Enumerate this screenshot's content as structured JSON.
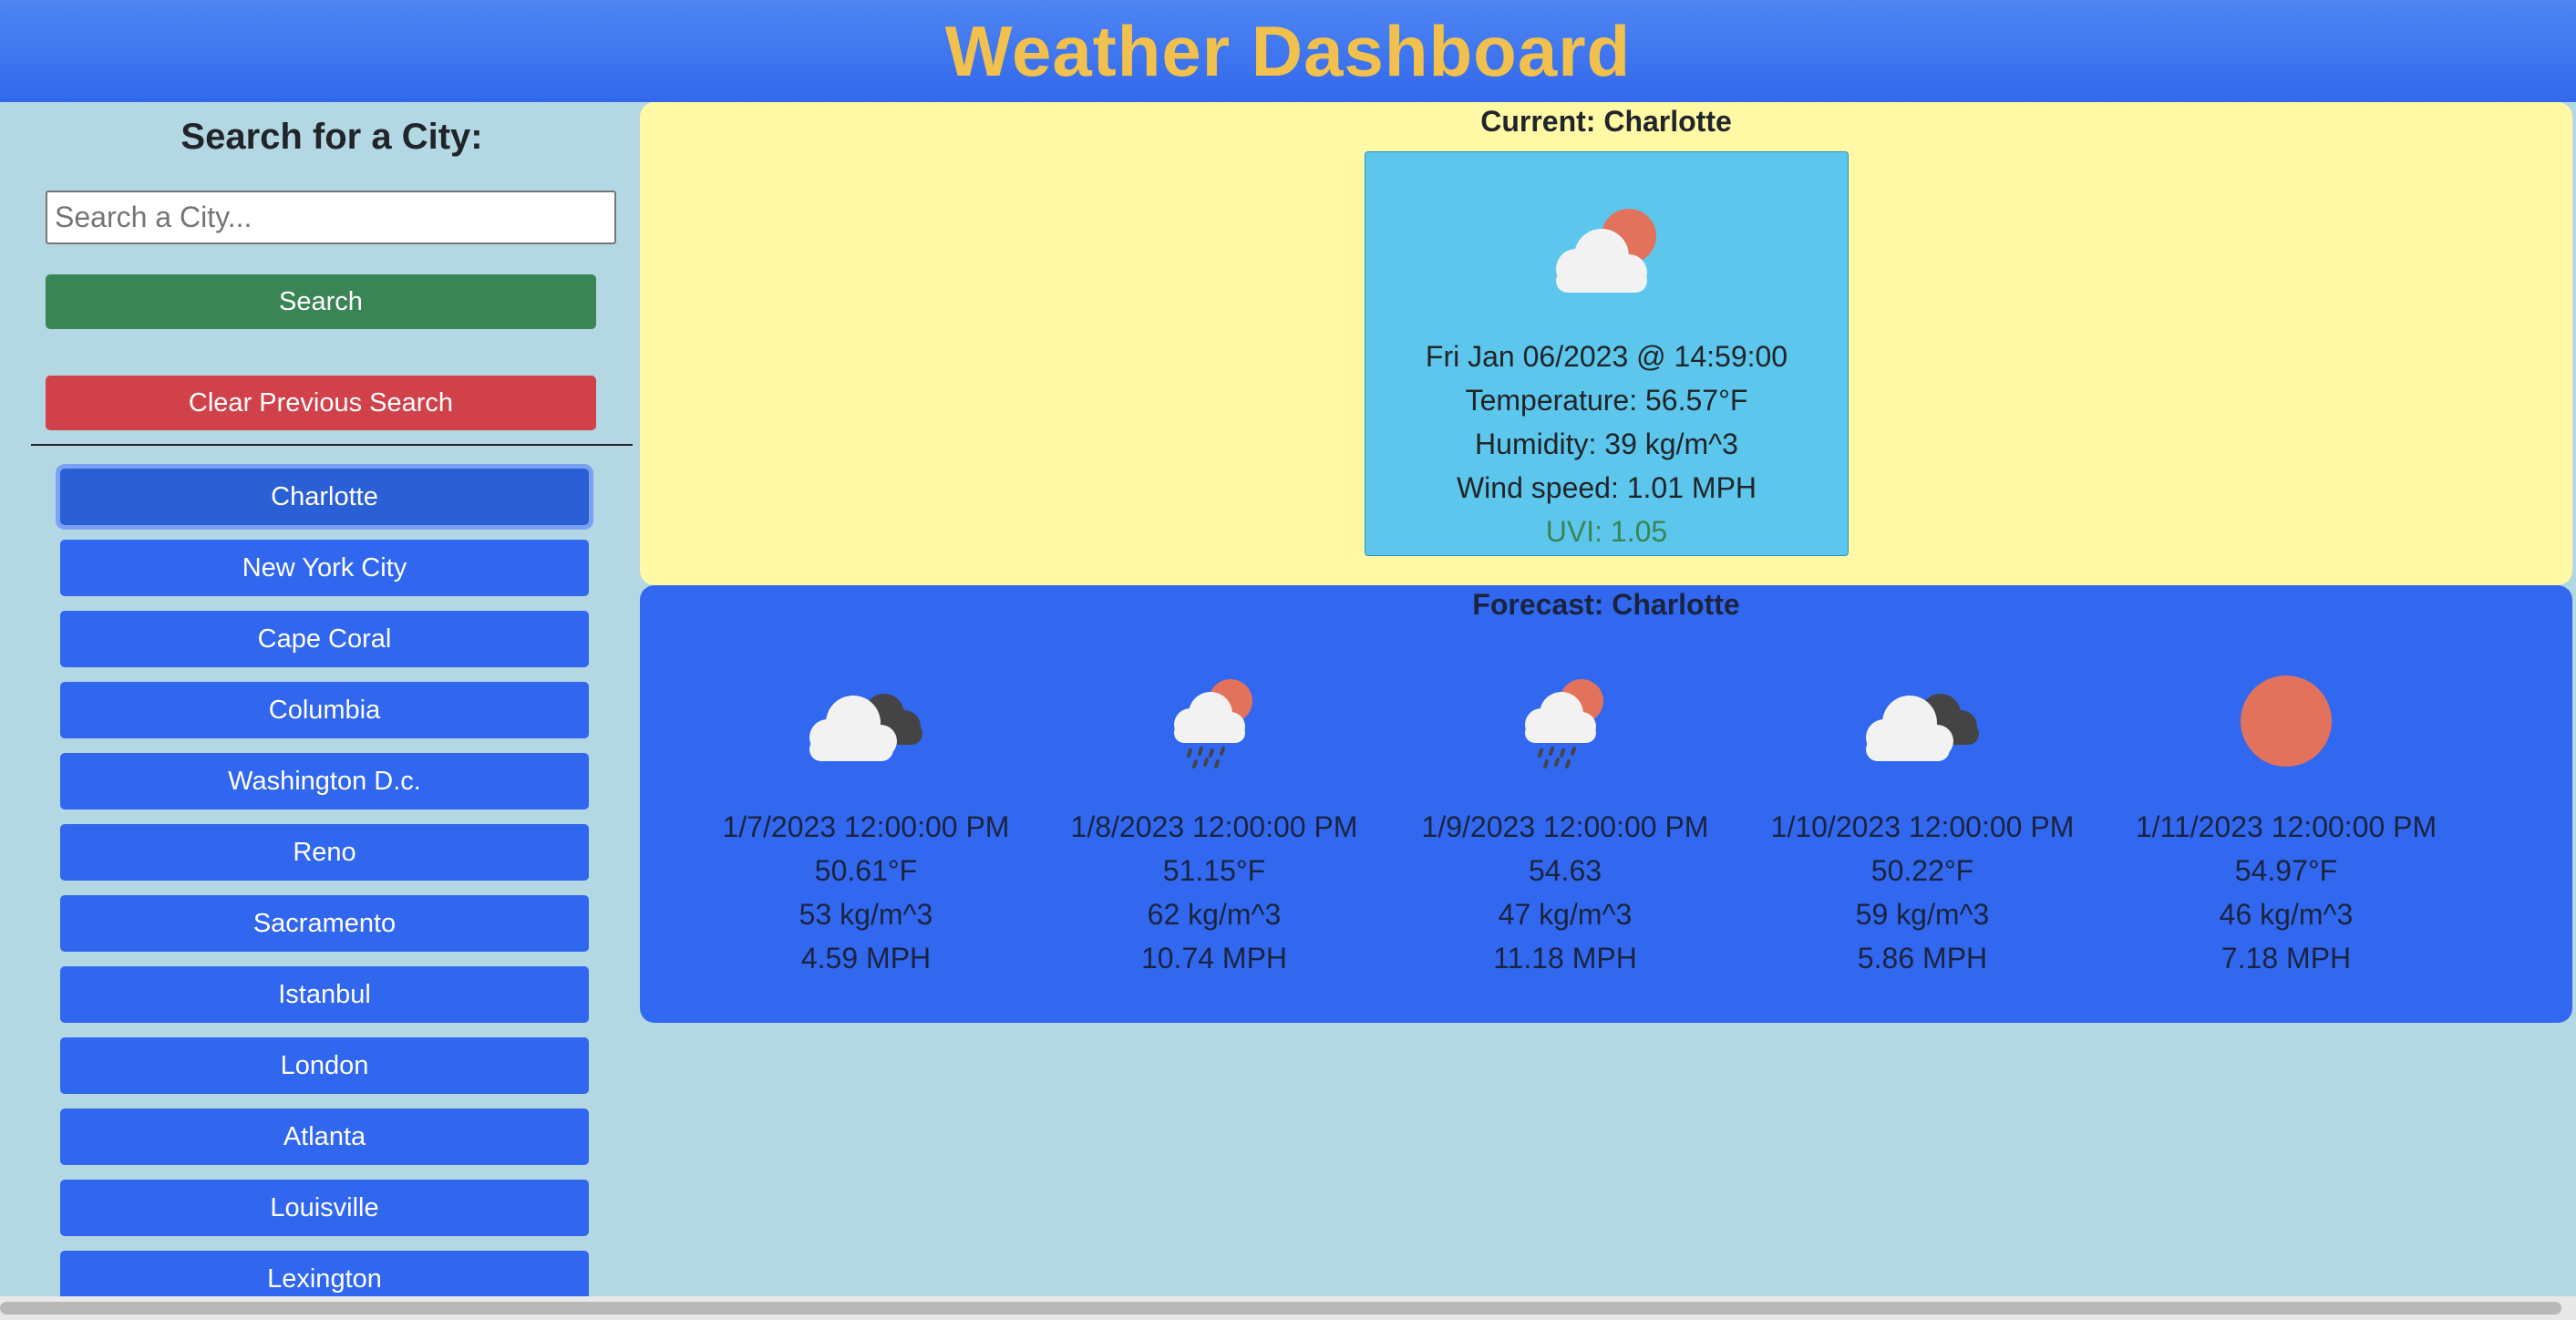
{
  "header": {
    "title": "Weather Dashboard"
  },
  "sidebar": {
    "search_title": "Search for a City:",
    "search_placeholder": "Search a City...",
    "search_button": "Search",
    "clear_button": "Clear Previous Search",
    "cities": [
      "Charlotte",
      "New York City",
      "Cape Coral",
      "Columbia",
      "Washington D.c.",
      "Reno",
      "Sacramento",
      "Istanbul",
      "London",
      "Atlanta",
      "Louisville",
      "Lexington"
    ],
    "active_city": "Charlotte"
  },
  "current": {
    "title": "Current: Charlotte",
    "icon": "cloud-sun-icon",
    "datetime": "Fri Jan 06/2023 @ 14:59:00",
    "temperature": "Temperature: 56.57°F",
    "humidity": "Humidity: 39 kg/m^3",
    "wind": "Wind speed: 1.01 MPH",
    "uvi": "UVI: 1.05",
    "uvi_color": "#3a8555"
  },
  "forecast": {
    "title": "Forecast: Charlotte",
    "days": [
      {
        "icon": "cloud-dark-icon",
        "date": "1/7/2023 12:00:00 PM",
        "temp": "50.61°F",
        "humidity": "53 kg/m^3",
        "wind": "4.59 MPH"
      },
      {
        "icon": "rain-sun-icon",
        "date": "1/8/2023 12:00:00 PM",
        "temp": "51.15°F",
        "humidity": "62 kg/m^3",
        "wind": "10.74 MPH"
      },
      {
        "icon": "rain-sun-icon",
        "date": "1/9/2023 12:00:00 PM",
        "temp": "54.63",
        "humidity": "47 kg/m^3",
        "wind": "11.18 MPH"
      },
      {
        "icon": "cloud-dark-icon",
        "date": "1/10/2023 12:00:00 PM",
        "temp": "50.22°F",
        "humidity": "59 kg/m^3",
        "wind": "5.86 MPH"
      },
      {
        "icon": "sun-icon",
        "date": "1/11/2023 12:00:00 PM",
        "temp": "54.97°F",
        "humidity": "46 kg/m^3",
        "wind": "7.18 MPH"
      }
    ]
  },
  "colors": {
    "header_bg": "#3268ec",
    "title_color": "#f2c14d",
    "sidebar_bg": "#b3d8e3",
    "current_panel_bg": "#fff8a5",
    "current_card_bg": "#5cc6ec",
    "forecast_panel_bg": "#3168ef",
    "search_button_bg": "#3a8555",
    "clear_button_bg": "#d1414a",
    "city_button_bg": "#3166ef"
  }
}
